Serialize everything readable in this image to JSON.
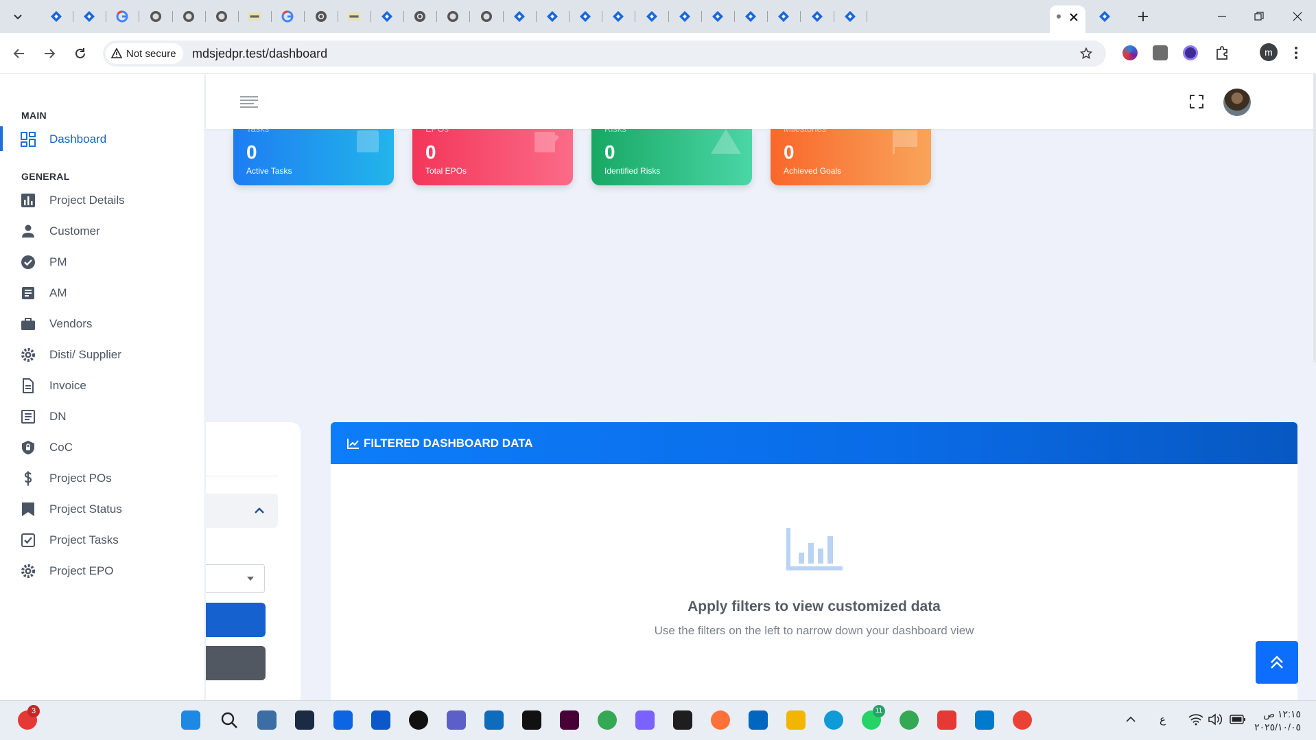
{
  "browser": {
    "tab_count_visible": 27,
    "security_label": "Not secure",
    "url": "mdsjedpr.test/dashboard",
    "profile_initial": "m"
  },
  "sidebar": {
    "sections": [
      {
        "title": "MAIN",
        "items": [
          {
            "label": "Dashboard",
            "icon": "dashboard-icon",
            "active": true
          }
        ]
      },
      {
        "title": "GENERAL",
        "items": [
          {
            "label": "Project Details",
            "icon": "bar-chart-icon"
          },
          {
            "label": "Customer",
            "icon": "person-icon"
          },
          {
            "label": "PM",
            "icon": "check-circle-icon"
          },
          {
            "label": "AM",
            "icon": "list-alt-icon"
          },
          {
            "label": "Vendors",
            "icon": "briefcase-icon"
          },
          {
            "label": "Disti/ Supplier",
            "icon": "gear-icon"
          },
          {
            "label": "Invoice",
            "icon": "document-icon"
          },
          {
            "label": "DN",
            "icon": "doc-list-icon"
          },
          {
            "label": "CoC",
            "icon": "shield-lock-icon"
          },
          {
            "label": "Project POs",
            "icon": "dollar-icon"
          },
          {
            "label": "Project Status",
            "icon": "bookmark-icon"
          },
          {
            "label": "Project Tasks",
            "icon": "checkbox-icon"
          },
          {
            "label": "Project EPO",
            "icon": "gear-icon"
          }
        ]
      }
    ]
  },
  "stats": [
    {
      "value": "0",
      "caption": "Active Tasks",
      "top": "Tasks",
      "color_from": "#1d7df2",
      "color_to": "#22b5ea",
      "icon": "list-icon"
    },
    {
      "value": "0",
      "caption": "Total EPOs",
      "top": "EPOs",
      "color_from": "#f3365a",
      "color_to": "#fb6b87",
      "icon": "edit-doc-icon"
    },
    {
      "value": "0",
      "caption": "Identified Risks",
      "top": "Risks",
      "color_from": "#18a864",
      "color_to": "#4ad6a6",
      "icon": "warning-icon"
    },
    {
      "value": "0",
      "caption": "Achieved Goals",
      "top": "Milestones",
      "color_from": "#f9672b",
      "color_to": "#f9a45a",
      "icon": "flag-icon"
    }
  ],
  "filtered": {
    "header": "FILTERED DASHBOARD DATA",
    "empty_title": "Apply filters to view customized data",
    "empty_subtitle": "Use the filters on the left to narrow down your dashboard view"
  },
  "taskbar": {
    "clock_time": "١٢:١٥ ص",
    "clock_date": "٢٠٢٥/١٠/٠٥",
    "lang": "ع",
    "badge_whatsapp": "11",
    "badge_app": "3"
  },
  "colors": {
    "primary": "#0d6efd",
    "sidebar_active": "#1e6fd9"
  }
}
